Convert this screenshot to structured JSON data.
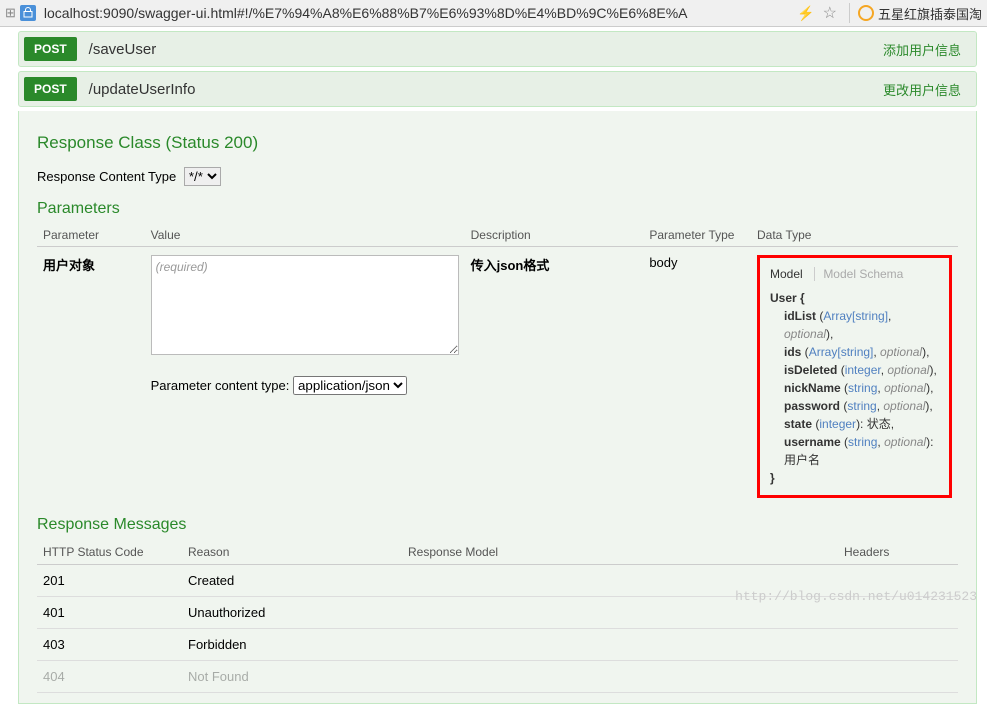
{
  "browser": {
    "url": "localhost:9090/swagger-ui.html#!/%E7%94%A8%E6%88%B7%E6%93%8D%E4%BD%9C%E6%8E%A",
    "extension_text": "五星红旗插泰国淘"
  },
  "endpoints": {
    "saveUser": {
      "method": "POST",
      "path": "/saveUser",
      "summary": "添加用户信息"
    },
    "updateUserInfo": {
      "method": "POST",
      "path": "/updateUserInfo",
      "summary": "更改用户信息"
    }
  },
  "response_class": {
    "title": "Response Class (Status 200)",
    "content_type_label": "Response Content Type",
    "content_type_value": "*/*"
  },
  "parameters": {
    "title": "Parameters",
    "headers": {
      "name": "Parameter",
      "value": "Value",
      "description": "Description",
      "type": "Parameter Type",
      "data_type": "Data Type"
    },
    "row": {
      "name": "用户对象",
      "value_placeholder": "(required)",
      "description": "传入json格式",
      "type": "body",
      "content_type_label": "Parameter content type:",
      "content_type_value": "application/json"
    }
  },
  "model": {
    "tab_model": "Model",
    "tab_schema": "Model Schema",
    "name": "User",
    "open": "User {",
    "close": "}",
    "props": {
      "idList": {
        "name": "idList",
        "type": "Array[string]",
        "optional": true,
        "desc": ""
      },
      "ids": {
        "name": "ids",
        "type": "Array[string]",
        "optional": true,
        "desc": ""
      },
      "isDeleted": {
        "name": "isDeleted",
        "type": "integer",
        "optional": true,
        "desc": ""
      },
      "nickName": {
        "name": "nickName",
        "type": "string",
        "optional": true,
        "desc": ""
      },
      "password": {
        "name": "password",
        "type": "string",
        "optional": true,
        "desc": ""
      },
      "state": {
        "name": "state",
        "type": "integer",
        "optional": false,
        "desc": "状态"
      },
      "username": {
        "name": "username",
        "type": "string",
        "optional": true,
        "desc": "用户名"
      }
    }
  },
  "responses": {
    "title": "Response Messages",
    "headers": {
      "code": "HTTP Status Code",
      "reason": "Reason",
      "model": "Response Model",
      "headers": "Headers"
    },
    "rows": [
      {
        "code": "201",
        "reason": "Created"
      },
      {
        "code": "401",
        "reason": "Unauthorized"
      },
      {
        "code": "403",
        "reason": "Forbidden"
      },
      {
        "code": "404",
        "reason": "Not Found"
      }
    ]
  },
  "labels": {
    "optional": "optional"
  },
  "watermark": "http://blog.csdn.net/u014231523"
}
